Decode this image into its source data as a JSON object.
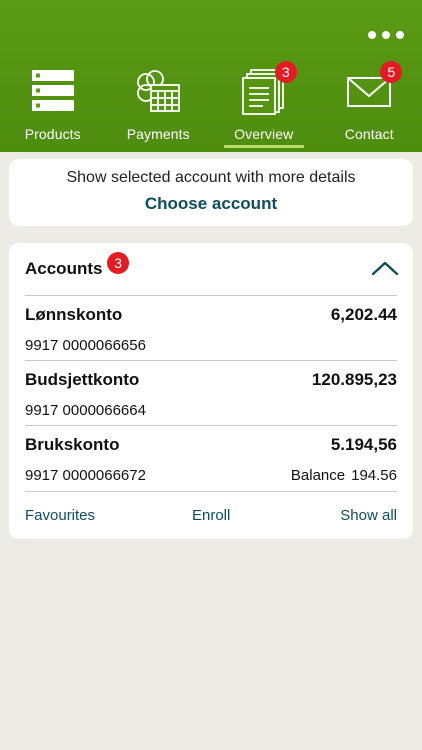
{
  "colors": {
    "header_green": "#5a9a14",
    "badge_red": "#e31b23",
    "link_teal": "#0f4c5c",
    "active_underline": "#b9dc6a",
    "background": "#ecebe6"
  },
  "header": {
    "more_icon": "more-dots-icon",
    "nav": [
      {
        "label": "Products",
        "icon": "products-list-icon",
        "badge": null,
        "active": false
      },
      {
        "label": "Payments",
        "icon": "payments-calendar-icon",
        "badge": null,
        "active": false
      },
      {
        "label": "Overview",
        "icon": "overview-documents-icon",
        "badge": "3",
        "active": true
      },
      {
        "label": "Contact",
        "icon": "mail-icon",
        "badge": "5",
        "active": false
      }
    ]
  },
  "choose_card": {
    "description": "Show selected account with more details",
    "link": "Choose account"
  },
  "accounts_card": {
    "title": "Accounts",
    "badge": "3",
    "collapse_icon": "chevron-up-icon",
    "rows": [
      {
        "name": "Lønnskonto",
        "amount": "6,202.44",
        "number": "9917 0000066656",
        "balance_label": "",
        "balance_value": ""
      },
      {
        "name": "Budsjettkonto",
        "amount": "120.895,23",
        "number": "9917 0000066664",
        "balance_label": "",
        "balance_value": ""
      },
      {
        "name": "Brukskonto",
        "amount": "5.194,56",
        "number": "9917 0000066672",
        "balance_label": "Balance",
        "balance_value": "194.56"
      }
    ],
    "footer": {
      "favourites": "Favourites",
      "enroll": "Enroll",
      "show_all": "Show all"
    }
  }
}
